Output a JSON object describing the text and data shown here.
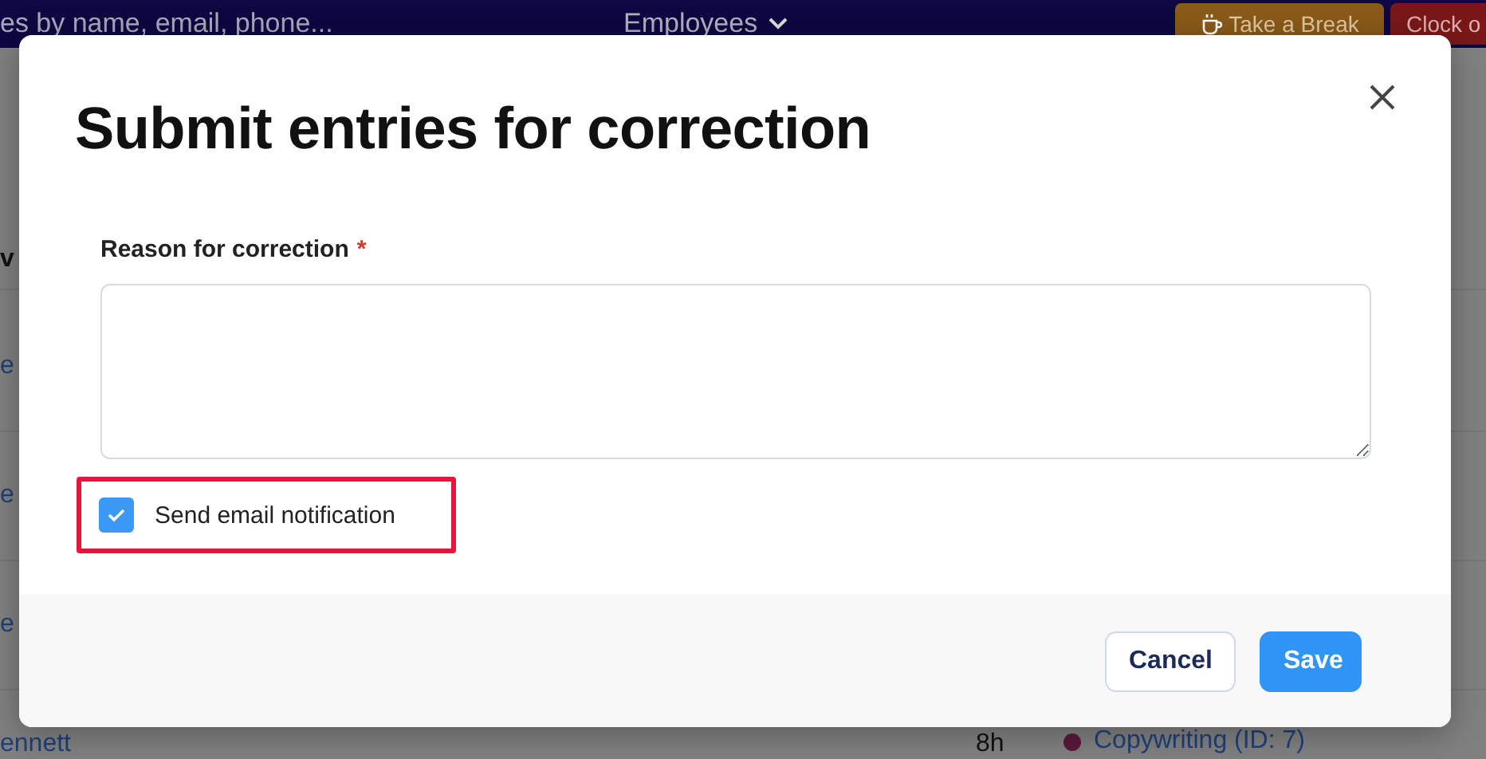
{
  "page": {
    "search": {
      "placeholder": "es by name, email, phone..."
    },
    "filter": {
      "label": "Employees"
    },
    "actions": [
      {
        "kind": "break",
        "label": "Take a Break"
      },
      {
        "kind": "clock",
        "label": "Clock o"
      }
    ],
    "table": {
      "header": "v",
      "rows": [
        {
          "name": "e"
        },
        {
          "name": "e"
        },
        {
          "name": "e"
        },
        {
          "name": "ennett",
          "hours": "8h",
          "project": "Copywriting (ID: 7)",
          "color": "#5a1a3a"
        }
      ]
    }
  },
  "dialog": {
    "title": "Submit entries for correction",
    "field": {
      "label": "Reason for correction",
      "required_mark": "*"
    },
    "notify": {
      "label": "Send email notification",
      "checked": true,
      "highlighted": true
    },
    "buttons": [
      {
        "kind": "secondary",
        "label": "Cancel"
      },
      {
        "kind": "primary",
        "label": "Save"
      }
    ]
  }
}
